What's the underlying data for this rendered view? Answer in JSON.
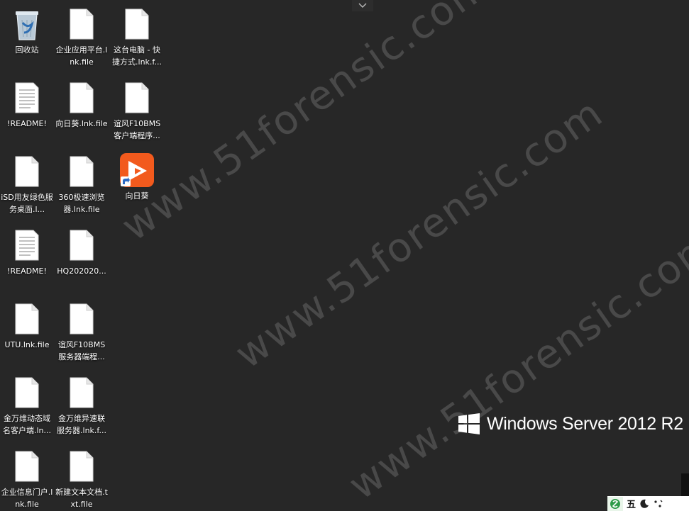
{
  "desktop_icons": [
    {
      "label": "回收站",
      "icon": "recycle-bin-icon"
    },
    {
      "label": "企业应用平台.lnk.file",
      "icon": "blank-file-icon"
    },
    {
      "label": "这台电脑 - 快捷方式.lnk.f...",
      "icon": "blank-file-icon"
    },
    {
      "label": "!README!",
      "icon": "text-document-icon"
    },
    {
      "label": "向日葵.lnk.file",
      "icon": "blank-file-icon"
    },
    {
      "label": "谊风F10BMS客户端程序...",
      "icon": "blank-file-icon"
    },
    {
      "label": "iSD用友绿色服务桌面.l...",
      "icon": "blank-file-icon"
    },
    {
      "label": "360极速浏览器.lnk.file",
      "icon": "blank-file-icon"
    },
    {
      "label": "向日葵",
      "icon": "sunlogin-app-icon"
    },
    {
      "label": "!README!",
      "icon": "text-document-icon"
    },
    {
      "label": "HQ202020...",
      "icon": "blank-file-icon"
    },
    {
      "label": "UTU.lnk.file",
      "icon": "blank-file-icon"
    },
    {
      "label": "谊风F10BMS服务器端程...",
      "icon": "blank-file-icon"
    },
    {
      "label": "金万维动态域名客户端.ln...",
      "icon": "blank-file-icon"
    },
    {
      "label": "金万维异速联服务器.lnk.f...",
      "icon": "blank-file-icon"
    },
    {
      "label": "企业信息门户.lnk.file",
      "icon": "blank-file-icon"
    },
    {
      "label": "新建文本文档.txt.file",
      "icon": "blank-file-icon"
    }
  ],
  "watermark": {
    "text": "www.51forensic.com"
  },
  "branding": {
    "text": "Windows Server 2012 R2"
  },
  "ime": {
    "mode_label": "五",
    "icons": [
      "moon-icon",
      "punctuation-icon"
    ]
  },
  "colors": {
    "desktop_bg": "#272727",
    "sunlogin_orange": "#f25a1d"
  }
}
